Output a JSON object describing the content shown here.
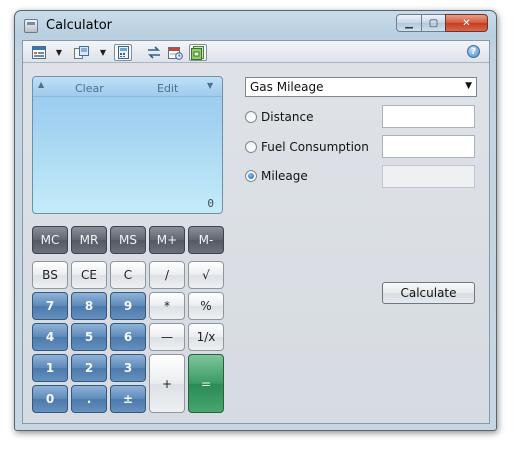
{
  "window": {
    "title": "Calculator",
    "minimize": "▁",
    "maximize": "▢",
    "close": "✕"
  },
  "toolbar": {
    "icons": [
      "view-menu-icon",
      "copy-paste-icon",
      "history-panel-icon",
      "unit-conversion-icon",
      "date-calculation-icon",
      "worksheets-icon",
      "help-icon"
    ],
    "caret": "▼",
    "help": "?"
  },
  "display": {
    "clear_label": "Clear",
    "edit_label": "Edit",
    "up_arrow": "▲",
    "down_arrow": "▼",
    "value": "0"
  },
  "memory_keys": [
    "MC",
    "MR",
    "MS",
    "M+",
    "M-"
  ],
  "keys": {
    "backspace": "BS",
    "clear_entry": "CE",
    "clear": "C",
    "divide": "/",
    "sqrt": "√",
    "seven": "7",
    "eight": "8",
    "nine": "9",
    "multiply": "*",
    "percent": "%",
    "four": "4",
    "five": "5",
    "six": "6",
    "minus": "—",
    "reciprocal": "1/x",
    "one": "1",
    "two": "2",
    "three": "3",
    "plus": "+",
    "equals": "=",
    "zero": "0",
    "decimal": ".",
    "negate": "±"
  },
  "worksheet": {
    "selected": "Gas Mileage",
    "options": [
      {
        "label": "Distance",
        "checked": false,
        "value": ""
      },
      {
        "label": "Fuel Consumption",
        "checked": false,
        "value": ""
      },
      {
        "label": "Mileage",
        "checked": true,
        "value": ""
      }
    ],
    "calculate_label": "Calculate"
  }
}
